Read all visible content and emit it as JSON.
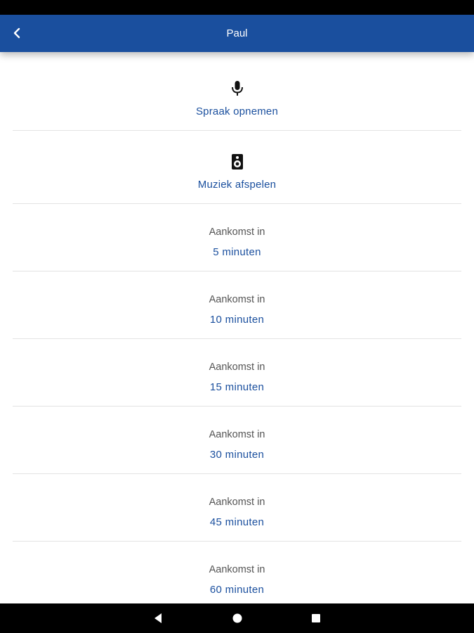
{
  "app_bar": {
    "title": "Paul",
    "back_icon": "chevron-left-icon",
    "background_color": "#1a4f9e"
  },
  "actions": [
    {
      "label": "Spraak opnemen",
      "icon": "microphone-icon"
    },
    {
      "label": "Muziek afspelen",
      "icon": "speaker-icon"
    }
  ],
  "arrival_options": [
    {
      "caption": "Aankomst in",
      "value": "5 minuten"
    },
    {
      "caption": "Aankomst in",
      "value": "10 minuten"
    },
    {
      "caption": "Aankomst in",
      "value": "15 minuten"
    },
    {
      "caption": "Aankomst in",
      "value": "30 minuten"
    },
    {
      "caption": "Aankomst in",
      "value": "45 minuten"
    },
    {
      "caption": "Aankomst in",
      "value": "60 minuten"
    }
  ],
  "nav_bar": {
    "back_icon": "triangle-back-icon",
    "home_icon": "circle-home-icon",
    "recents_icon": "square-recents-icon"
  }
}
